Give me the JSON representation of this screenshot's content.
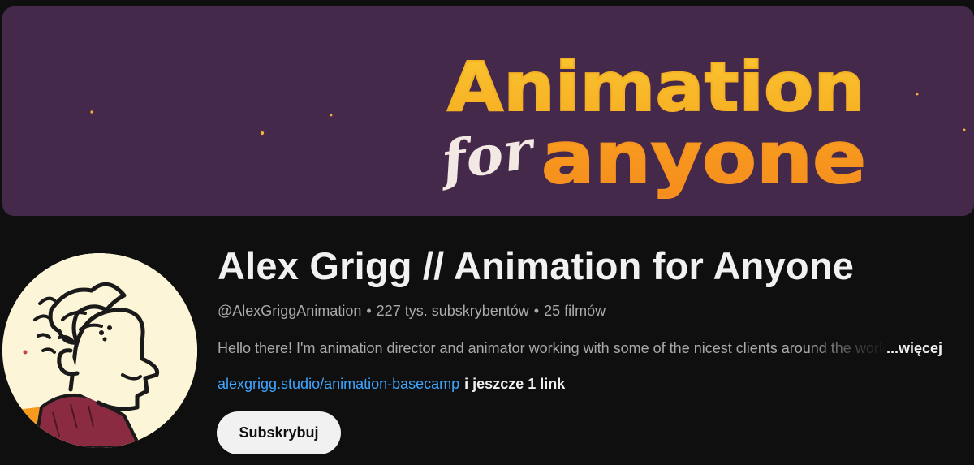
{
  "banner": {
    "logo_line1": "Animation",
    "logo_for": "for",
    "logo_line2": "anyone",
    "colors": {
      "background": "#45294a",
      "yellow": "#f9be2b",
      "orange": "#f7921e",
      "script": "#f3e9e4"
    }
  },
  "channel": {
    "title": "Alex Grigg // Animation for Anyone",
    "handle": "@AlexGriggAnimation",
    "subscribers": "227 tys. subskrybentów",
    "videos": "25 filmów",
    "separator": "•",
    "description": "Hello there! I'm animation director and animator working with some of the nicest clients around the world",
    "more_label": "...więcej",
    "link_text": "alexgrigg.studio/animation-basecamp",
    "more_links": "i jeszcze 1 link",
    "subscribe_label": "Subskrybuj"
  },
  "colors": {
    "page_bg": "#0f0f0f",
    "text_primary": "#f1f1f1",
    "text_secondary": "#aaaaaa",
    "link": "#3ea6ff"
  }
}
